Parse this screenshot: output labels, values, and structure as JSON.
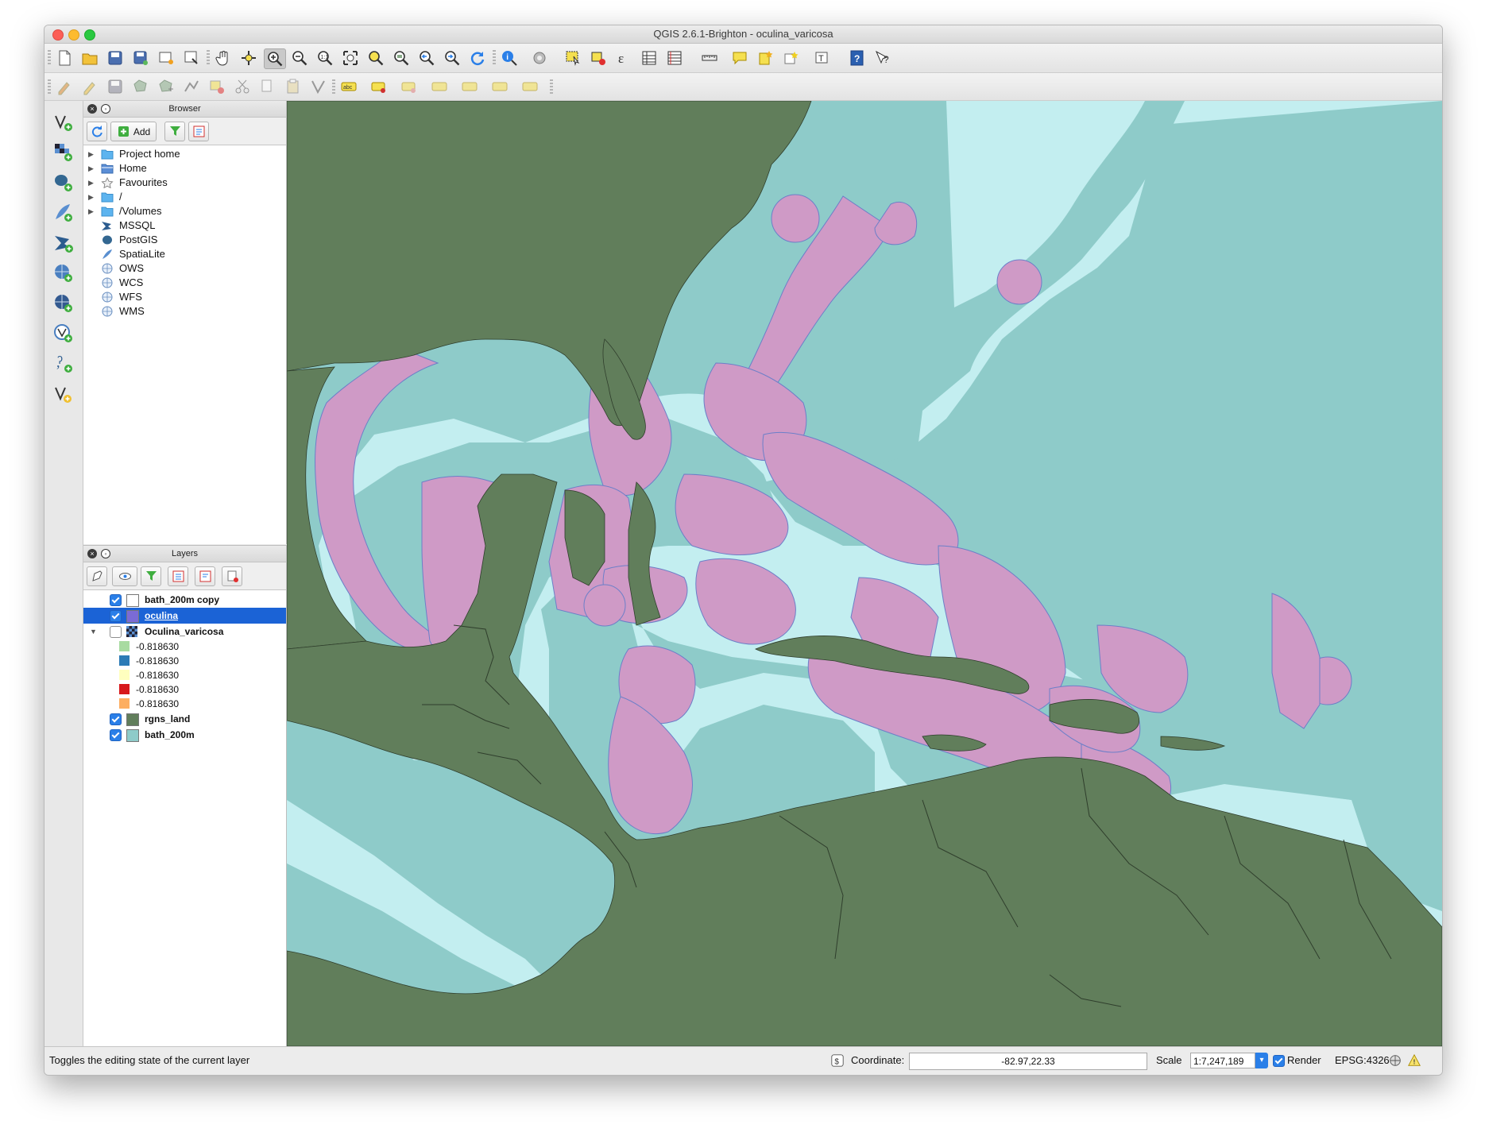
{
  "window": {
    "title": "QGIS 2.6.1-Brighton - oculina_varicosa"
  },
  "colors": {
    "land": "#617e5b",
    "shelf": "#c3eef0",
    "ocean": "#8ecbc9",
    "oculina": "#cf9ac6",
    "oculina_edge": "#6c7fc8",
    "selected_row": "#1b63d6"
  },
  "toolbar_main": {
    "icons": [
      "new-project-icon",
      "open-project-icon",
      "save-project-icon",
      "save-as-icon",
      "new-print-composer-icon",
      "composer-manager-icon",
      "pan-icon",
      "pan-to-selection-icon",
      "zoom-in-icon",
      "zoom-out-icon",
      "zoom-actual-icon",
      "zoom-full-icon",
      "zoom-to-selection-icon",
      "zoom-to-layer-icon",
      "zoom-last-icon",
      "zoom-next-icon",
      "refresh-icon",
      "identify-icon",
      "run-action-icon",
      "select-features-icon",
      "deselect-all-icon",
      "field-calculator-icon",
      "attribute-table-icon",
      "statistics-icon",
      "measure-icon",
      "map-tips-icon",
      "new-bookmark-icon",
      "show-bookmarks-icon",
      "text-annotation-icon",
      "help-icon",
      "whats-this-icon"
    ]
  },
  "toolbar_edit": {
    "icons": [
      "current-edits-icon",
      "toggle-editing-icon",
      "save-edits-icon",
      "add-feature-icon",
      "move-feature-icon",
      "node-tool-icon",
      "delete-selected-icon",
      "cut-features-icon",
      "copy-features-icon",
      "paste-features-icon",
      "digitize-icon",
      "label-icon",
      "pin-labels-icon",
      "highlight-pinned-icon",
      "show-hide-labels-icon",
      "move-label-icon",
      "rotate-label-icon",
      "change-label-icon"
    ]
  },
  "left_toolbar": {
    "icons": [
      "add-vector-layer-icon",
      "add-raster-layer-icon",
      "add-postgis-layer-icon",
      "add-spatialite-layer-icon",
      "add-mssql-layer-icon",
      "add-wms-layer-icon",
      "add-wcs-layer-icon",
      "add-wfs-layer-icon",
      "add-delimited-text-icon",
      "new-shapefile-icon"
    ]
  },
  "browser": {
    "title": "Browser",
    "add_label": "Add",
    "items": [
      {
        "label": "Project home",
        "icon": "folder-icon",
        "expandable": true
      },
      {
        "label": "Home",
        "icon": "home-folder-icon",
        "expandable": true
      },
      {
        "label": "Favourites",
        "icon": "star-icon",
        "expandable": true
      },
      {
        "label": "/",
        "icon": "folder-icon",
        "expandable": true
      },
      {
        "label": "/Volumes",
        "icon": "folder-icon",
        "expandable": true
      },
      {
        "label": "MSSQL",
        "icon": "mssql-icon",
        "expandable": false
      },
      {
        "label": "PostGIS",
        "icon": "postgis-icon",
        "expandable": false
      },
      {
        "label": "SpatiaLite",
        "icon": "spatialite-icon",
        "expandable": false
      },
      {
        "label": "OWS",
        "icon": "globe-icon",
        "expandable": false
      },
      {
        "label": "WCS",
        "icon": "globe-icon",
        "expandable": false
      },
      {
        "label": "WFS",
        "icon": "globe-icon",
        "expandable": false
      },
      {
        "label": "WMS",
        "icon": "globe-icon",
        "expandable": false
      }
    ]
  },
  "layers": {
    "title": "Layers",
    "items": [
      {
        "name": "bath_200m copy",
        "checked": true,
        "swatch": "#ffffff",
        "selected": false
      },
      {
        "name": "oculina",
        "checked": true,
        "swatch": "#7b6bd6",
        "selected": true
      },
      {
        "name": "Oculina_varicosa",
        "checked": false,
        "swatch": "raster",
        "selected": false,
        "expanded": true,
        "legend": [
          {
            "label": "-0.818630",
            "color": "#a8dba1"
          },
          {
            "label": "-0.818630",
            "color": "#2c7bb6"
          },
          {
            "label": "-0.818630",
            "color": "#ffffbf"
          },
          {
            "label": "-0.818630",
            "color": "#d7191c"
          },
          {
            "label": "-0.818630",
            "color": "#fdae61"
          }
        ]
      },
      {
        "name": "rgns_land",
        "checked": true,
        "swatch": "#617e5b",
        "selected": false
      },
      {
        "name": "bath_200m",
        "checked": true,
        "swatch": "#8ecbc9",
        "selected": false
      }
    ]
  },
  "status": {
    "message": "Toggles the editing state of the current layer",
    "coordinate_label": "Coordinate:",
    "coordinate_value": "-82.97,22.33",
    "scale_label": "Scale",
    "scale_value": "1:7,247,189",
    "render_label": "Render",
    "render_checked": true,
    "crs": "EPSG:4326"
  }
}
